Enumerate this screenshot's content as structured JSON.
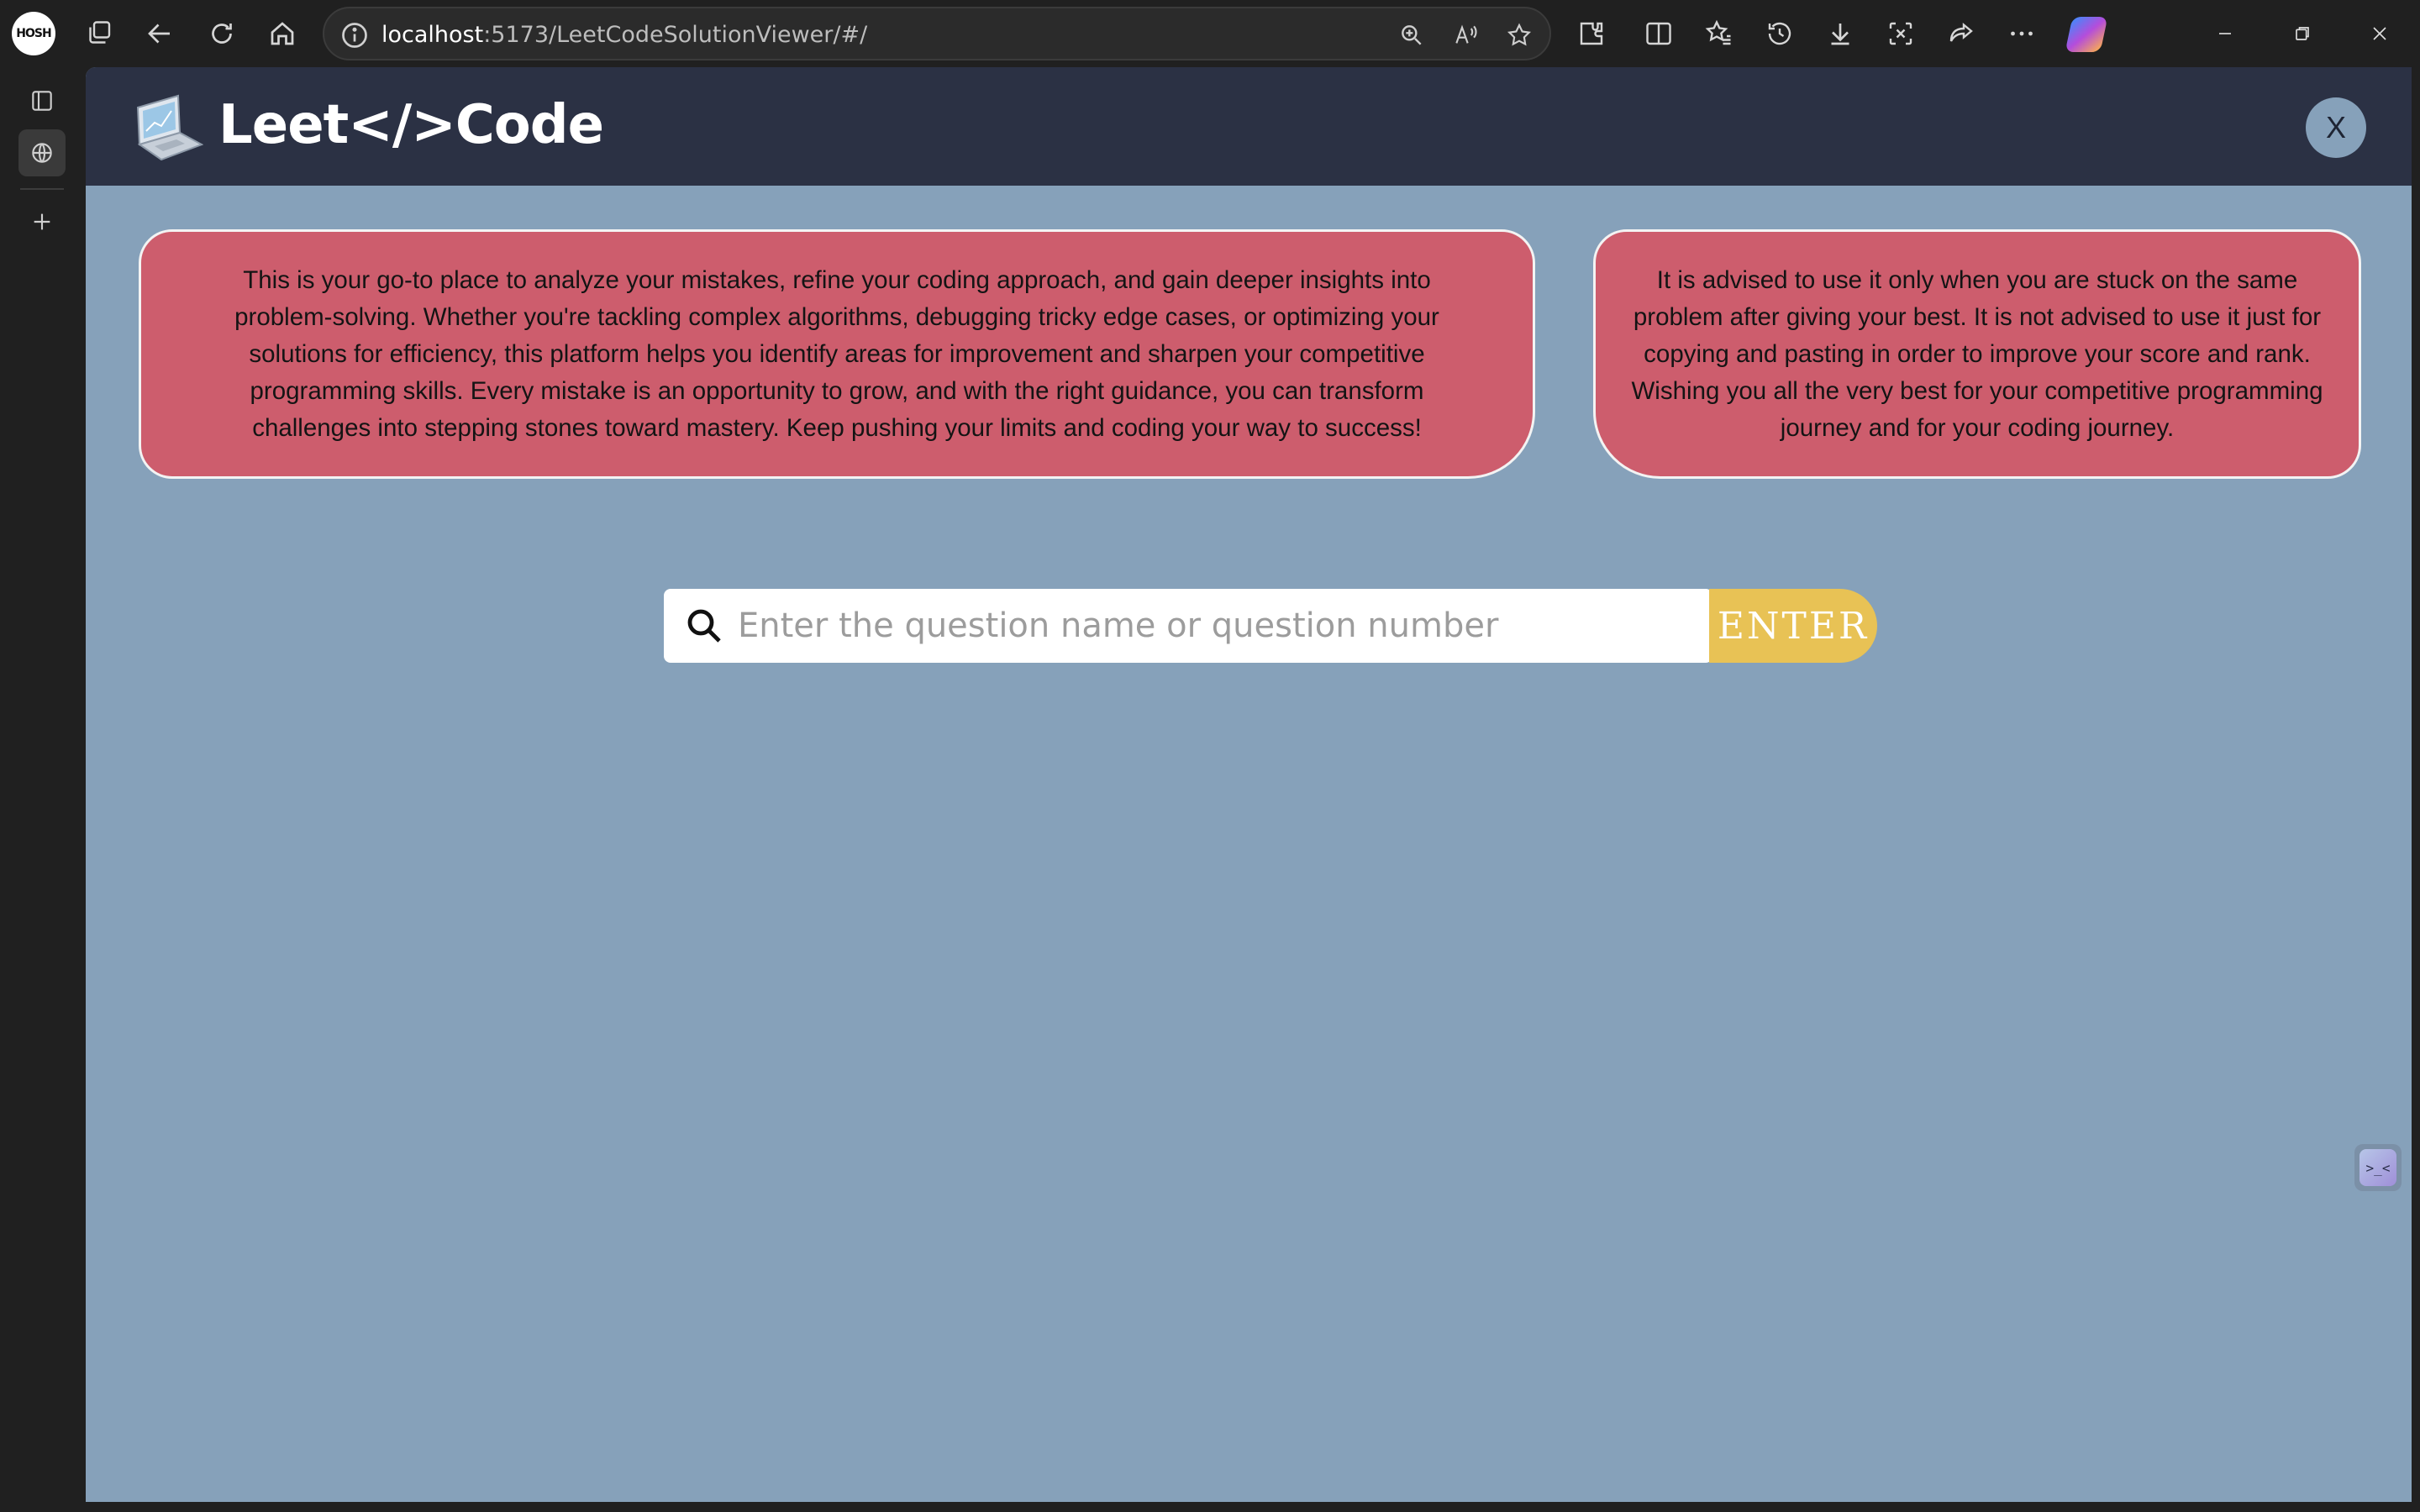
{
  "browser": {
    "profile_label": "HOSH",
    "url_host": "localhost",
    "url_rest": ":5173/LeetCodeSolutionViewer/#/"
  },
  "app": {
    "brand": "Leet</>Code",
    "close_label": "X"
  },
  "cards": {
    "intro": "This is your go-to place to analyze your mistakes, refine your coding approach, and gain deeper insights into problem-solving. Whether you're tackling complex algorithms, debugging tricky edge cases, or optimizing your solutions for efficiency, this platform helps you identify areas for improvement and sharpen your competitive programming skills. Every mistake is an opportunity to grow, and with the right guidance, you can transform challenges into stepping stones toward mastery. Keep pushing your limits and coding your way to success!",
    "advice": "It is advised to use it only when you are stuck on the same problem after giving your best. It is not advised to use it just for copying and pasting in order to improve your score and rank. Wishing you all the very best for your competitive programming journey and for your coding journey."
  },
  "search": {
    "placeholder": "Enter the question name or question number",
    "value": "",
    "button_label": "ENTER"
  },
  "floating_tab": {
    "label": ">_<"
  },
  "colors": {
    "page_bg": "#86a1ba",
    "header_bg": "#2b3144",
    "card_bg": "#cd5d6d",
    "enter_bg": "#e8c255"
  }
}
